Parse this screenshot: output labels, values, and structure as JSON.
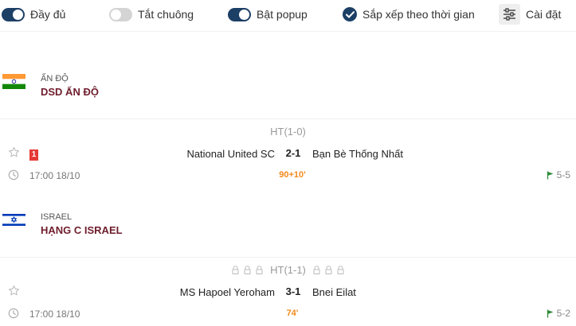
{
  "toolbar": {
    "full_label": "Đầy đủ",
    "mute_label": "Tắt chuông",
    "popup_label": "Bật popup",
    "sort_label": "Sắp xếp theo thời gian",
    "settings_label": "Cài đặt",
    "full_on": true,
    "mute_on": false,
    "popup_on": true,
    "sort_checked": true
  },
  "colors": {
    "accent": "#1c3f66",
    "league_name": "#6e1d2c",
    "live_minute": "#f28a1c",
    "red_card": "#e53935"
  },
  "leagues": [
    {
      "country": "Ấn Độ",
      "name": "DSD ẤN ĐỘ",
      "flag": "india-flag",
      "match": {
        "halftime": "HT(1-0)",
        "home": "National United SC",
        "score": "2-1",
        "away": "Bạn Bè Thống Nhất",
        "red_cards": "1",
        "kickoff": "17:00 18/10",
        "minute": "90+10'",
        "corners": "5-5"
      }
    },
    {
      "country": "Israel",
      "name": "HẠNG C ISRAEL",
      "flag": "israel-flag",
      "match": {
        "halftime": "HT(1-1)",
        "home": "MS Hapoel Yeroham",
        "score": "3-1",
        "away": "Bnei Eilat",
        "kickoff": "17:00 18/10",
        "minute": "74'",
        "corners": "5-2"
      }
    }
  ]
}
